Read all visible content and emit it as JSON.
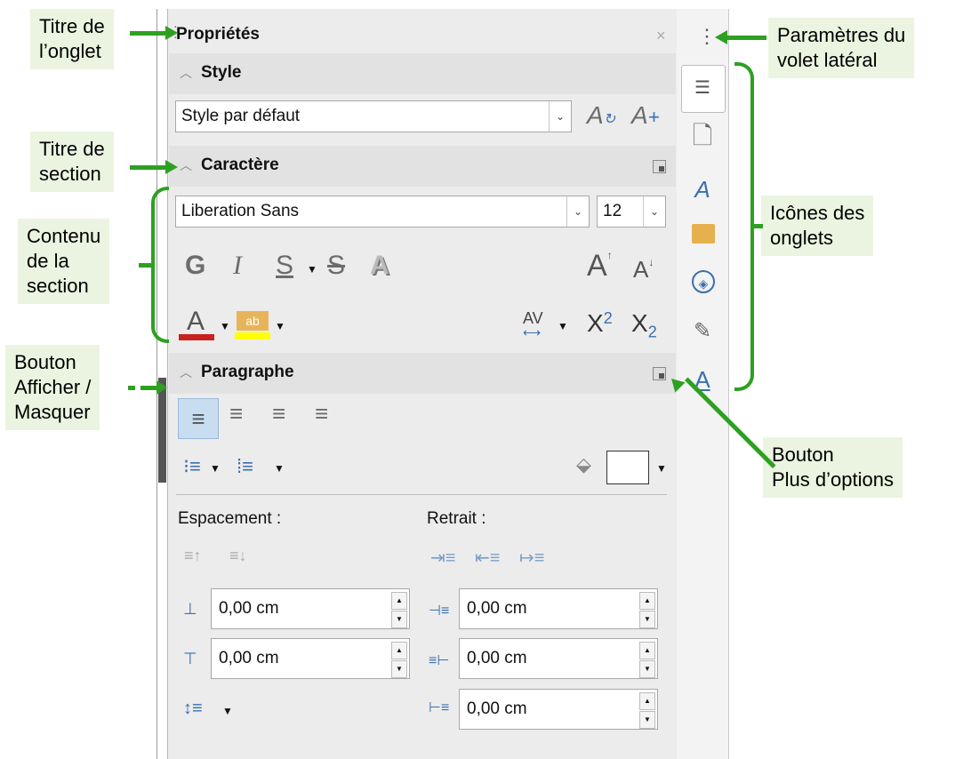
{
  "deck": {
    "title": "Propriétés",
    "close": "×",
    "settings": "⋮"
  },
  "style_section": {
    "title": "Style",
    "selected_style": "Style par défaut",
    "update_icon": "update-style-icon",
    "new_icon": "new-style-icon"
  },
  "character_section": {
    "title": "Caractère",
    "font_name": "Liberation Sans",
    "font_size": "12",
    "bold": "G",
    "italic": "I",
    "underline": "S",
    "strikethrough": "S",
    "shadow": "A",
    "grow": "A",
    "shrink": "A",
    "font_color": "A",
    "highlight": "ab",
    "spacing": "AV",
    "superscript": "X",
    "superscript_exp": "2",
    "subscript": "X",
    "subscript_exp": "2",
    "colors": {
      "font_color": "#c9211e",
      "highlight": "#ffff00"
    }
  },
  "paragraph_section": {
    "title": "Paragraphe",
    "spacing_label": "Espacement :",
    "indent_label": "Retrait :",
    "above_spacing": "0,00 cm",
    "below_spacing": "0,00 cm",
    "before_indent": "0,00 cm",
    "after_indent": "0,00 cm",
    "first_line_indent": "0,00 cm"
  },
  "tabs": [
    "properties-icon",
    "page-icon",
    "styles-icon",
    "gallery-icon",
    "navigator-icon",
    "manage-changes-icon",
    "design-icon"
  ],
  "annotations": {
    "tab_title": "Titre de\nl’onglet",
    "section_title": "Titre de\nsection",
    "section_content": "Contenu\nde la\nsection",
    "show_hide": "Bouton\nAfficher /\nMasquer",
    "sidebar_settings": "Paramètres du\nvolet latéral",
    "tab_icons": "Icônes des\nonglets",
    "more_options": "Bouton\nPlus d’options"
  },
  "colors": {
    "annotation_bg": "#eaf4e0",
    "arrow": "#2ea021"
  }
}
